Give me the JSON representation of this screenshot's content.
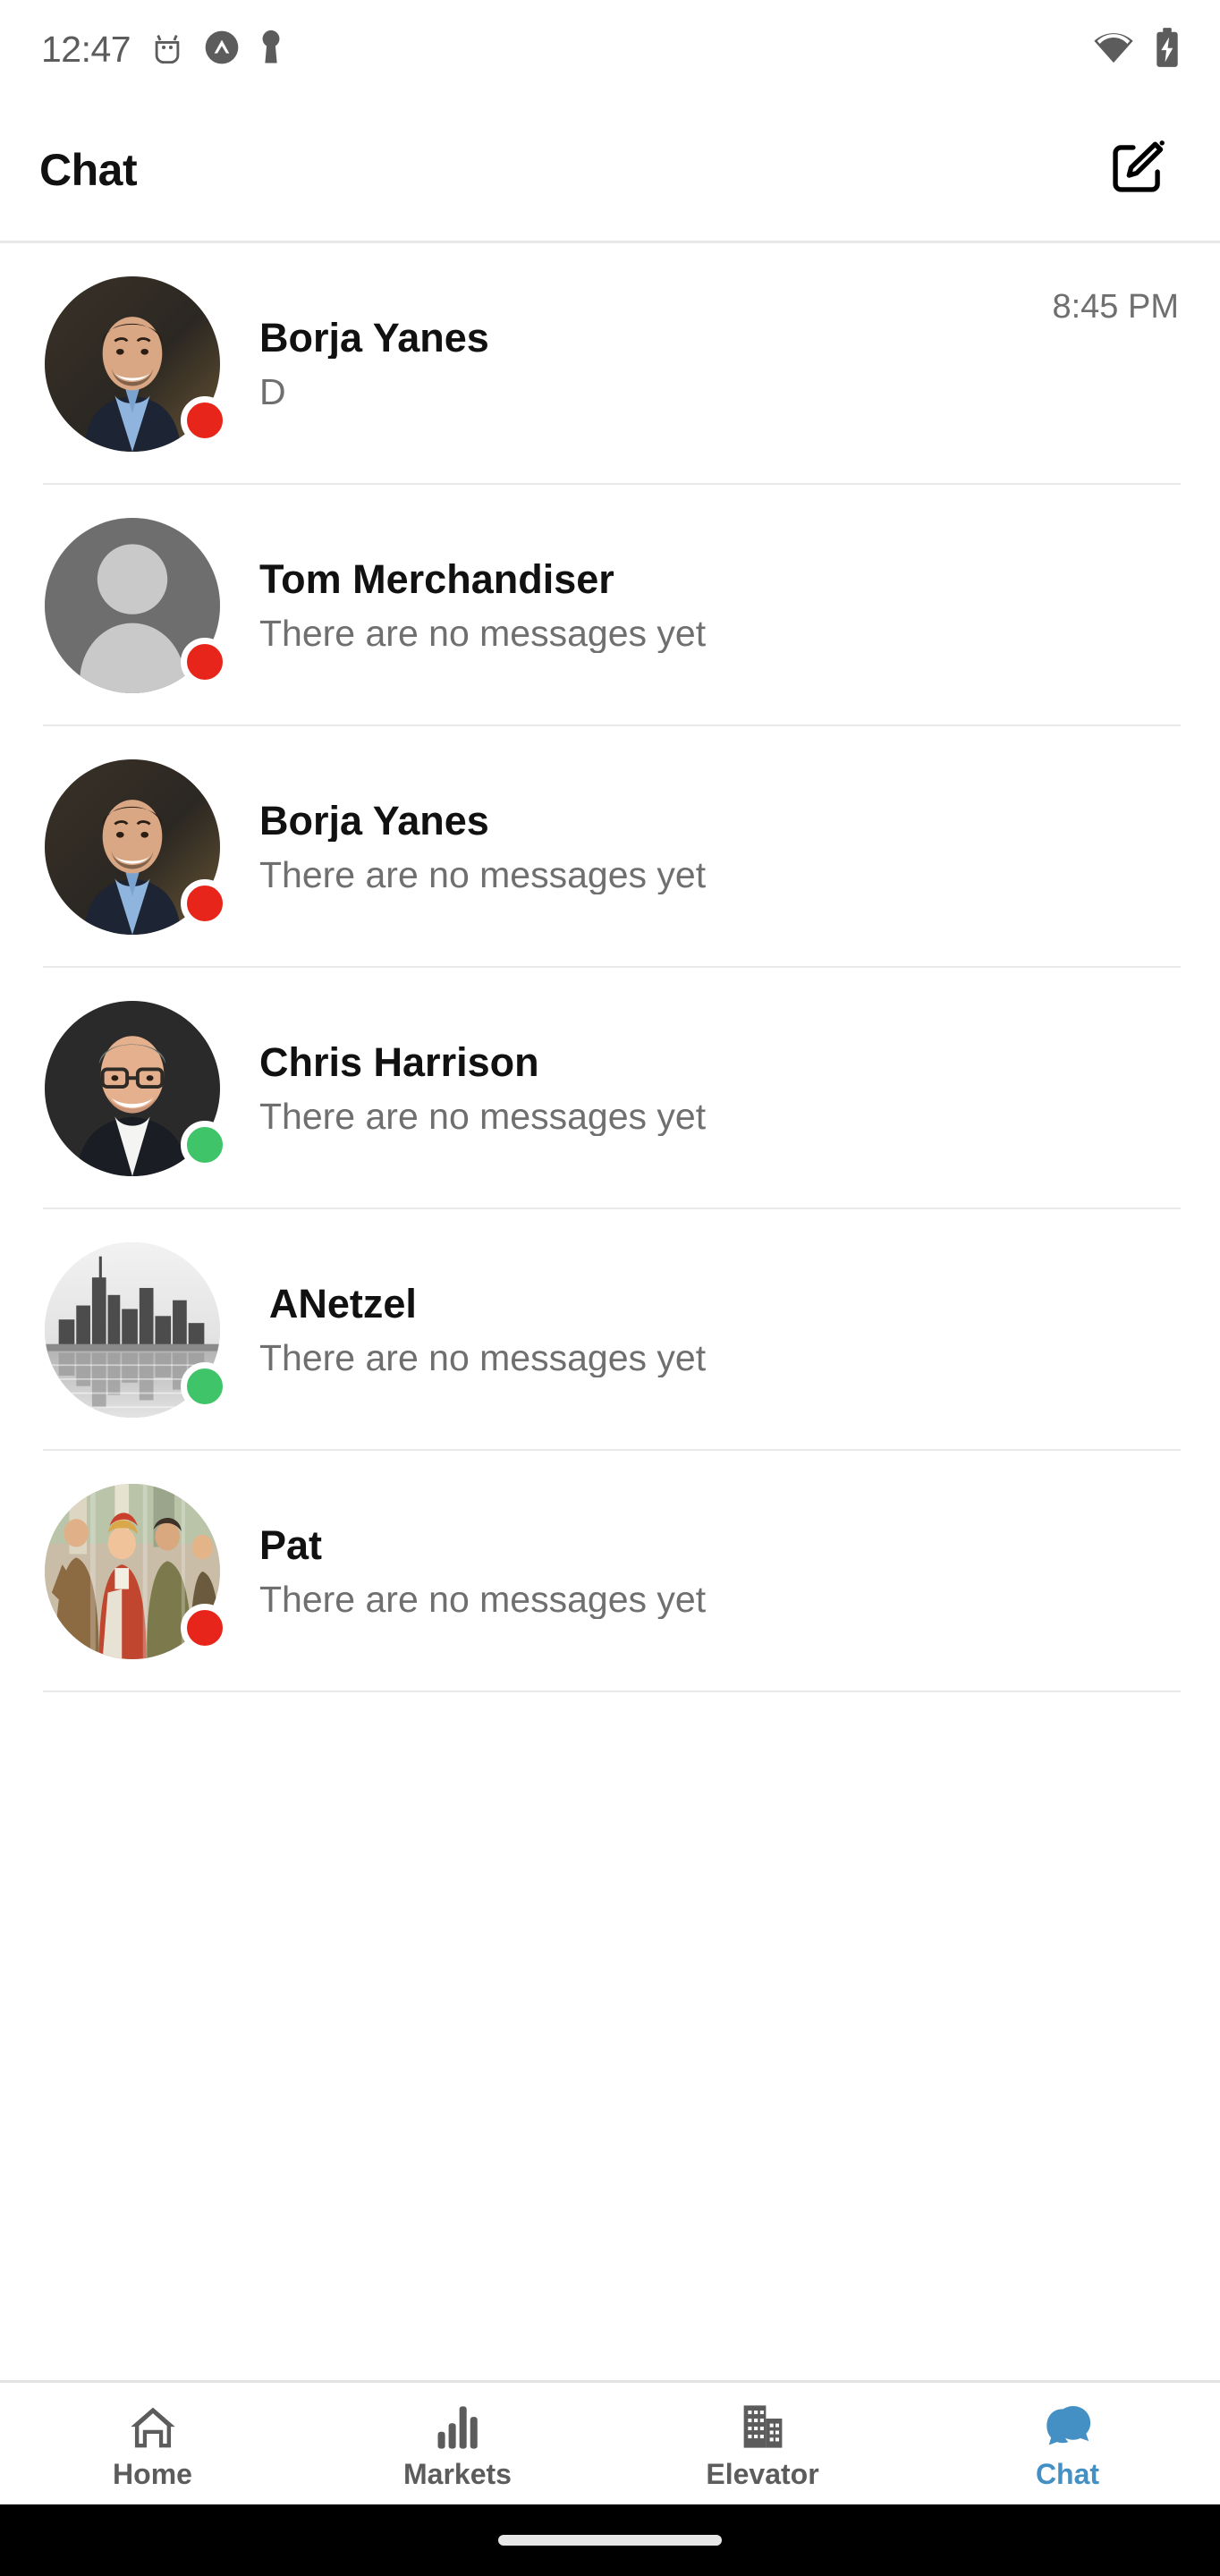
{
  "status_bar": {
    "time": "12:47",
    "left_icons": [
      "android-debug-icon",
      "app-badge-icon",
      "key-icon"
    ],
    "right_icons": [
      "wifi-icon",
      "battery-charging-icon"
    ],
    "icon_color": "#5c5c5c"
  },
  "header": {
    "title": "Chat",
    "compose_icon": "compose-icon"
  },
  "colors": {
    "accent": "#4490c4",
    "online": "#3fc46a",
    "offline": "#e8251b",
    "divider": "#e9e9e9",
    "primary_text": "#111111",
    "secondary_text": "#6f6f6f"
  },
  "chat_list": [
    {
      "name": "Borja Yanes",
      "preview": "D",
      "time": "8:45 PM",
      "status": "offline",
      "avatar_type": "photo-man-suit"
    },
    {
      "name": "Tom Merchandiser",
      "preview": "There are no messages yet",
      "time": "",
      "status": "offline",
      "avatar_type": "placeholder-person"
    },
    {
      "name": "Borja Yanes",
      "preview": "There are no messages yet",
      "time": "",
      "status": "offline",
      "avatar_type": "photo-man-suit"
    },
    {
      "name": "Chris Harrison",
      "preview": "There are no messages yet",
      "time": "",
      "status": "online",
      "avatar_type": "photo-man-glasses"
    },
    {
      "name": " ANetzel",
      "preview": "There are no messages yet",
      "time": "",
      "status": "online",
      "avatar_type": "photo-city-skyline"
    },
    {
      "name": "Pat",
      "preview": "There are no messages yet",
      "time": "",
      "status": "offline",
      "avatar_type": "photo-group"
    }
  ],
  "bottom_nav": {
    "active_index": 3,
    "items": [
      {
        "label": "Home",
        "icon": "home-icon"
      },
      {
        "label": "Markets",
        "icon": "bar-chart-icon"
      },
      {
        "label": "Elevator",
        "icon": "buildings-icon"
      },
      {
        "label": "Chat",
        "icon": "chat-bubbles-icon"
      }
    ]
  }
}
